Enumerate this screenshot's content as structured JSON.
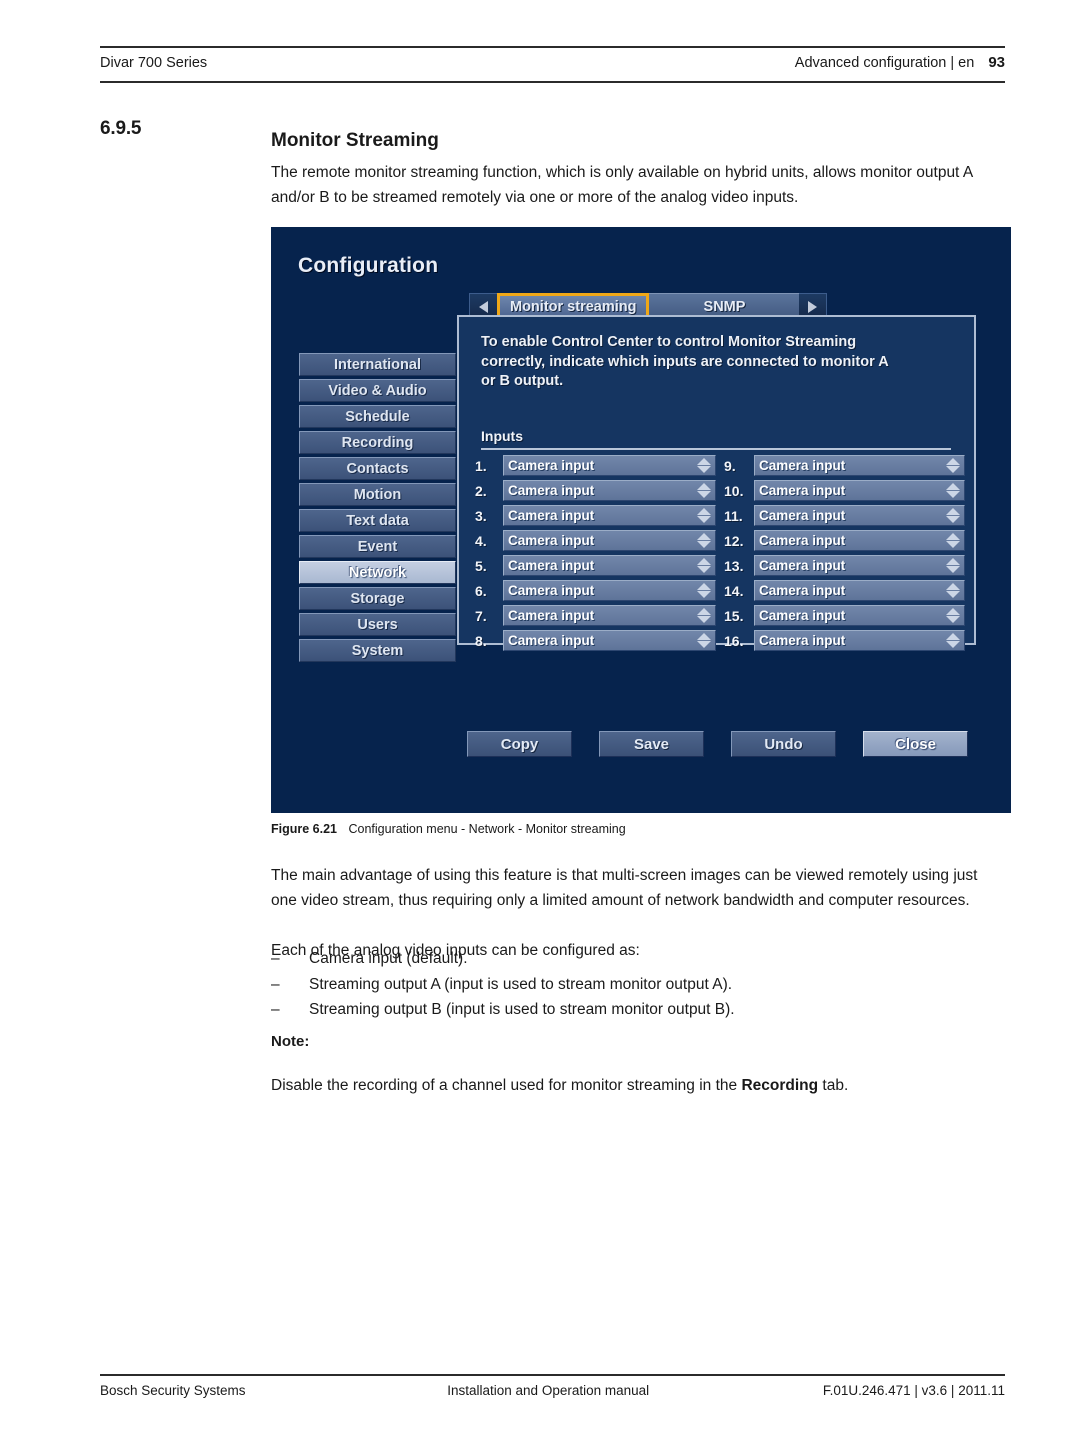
{
  "header": {
    "left": "Divar 700 Series",
    "right": "Advanced configuration | en",
    "page_number": "93"
  },
  "section": {
    "number": "6.9.5",
    "title": "Monitor Streaming",
    "intro": "The remote monitor streaming function, which is only available on hybrid units, allows monitor output A and/or B to be streamed remotely via one or more of the analog video inputs."
  },
  "figure": {
    "caption_label": "Figure 6.21",
    "caption_text": "Configuration menu - Network - Monitor streaming",
    "screenshot": {
      "window_title": "Configuration",
      "colors": {
        "background": "#06234d",
        "panel": "#153561",
        "panel_border": "#aebdd3",
        "tab_focus": "#f0a818",
        "button_face": "#4e658c",
        "highlight": "#a9b8d1"
      },
      "tabs": {
        "prev_arrow": "◀",
        "next_arrow": "▶",
        "items": [
          {
            "label": "Monitor streaming",
            "active": true
          },
          {
            "label": "SNMP",
            "active": false
          }
        ]
      },
      "sidebar": {
        "items": [
          {
            "label": "International",
            "active": false
          },
          {
            "label": "Video & Audio",
            "active": false
          },
          {
            "label": "Schedule",
            "active": false
          },
          {
            "label": "Recording",
            "active": false
          },
          {
            "label": "Contacts",
            "active": false
          },
          {
            "label": "Motion",
            "active": false
          },
          {
            "label": "Text data",
            "active": false
          },
          {
            "label": "Event",
            "active": false
          },
          {
            "label": "Network",
            "active": true
          },
          {
            "label": "Storage",
            "active": false
          },
          {
            "label": "Users",
            "active": false
          },
          {
            "label": "System",
            "active": false
          }
        ]
      },
      "panel": {
        "description": "To enable Control Center to control Monitor Streaming correctly, indicate which inputs are connected to monitor A or B output.",
        "inputs_label": "Inputs",
        "inputs_left": [
          {
            "num": "1.",
            "value": "Camera input"
          },
          {
            "num": "2.",
            "value": "Camera input"
          },
          {
            "num": "3.",
            "value": "Camera input"
          },
          {
            "num": "4.",
            "value": "Camera input"
          },
          {
            "num": "5.",
            "value": "Camera input"
          },
          {
            "num": "6.",
            "value": "Camera input"
          },
          {
            "num": "7.",
            "value": "Camera input"
          },
          {
            "num": "8.",
            "value": "Camera input"
          }
        ],
        "inputs_right": [
          {
            "num": "9.",
            "value": "Camera input"
          },
          {
            "num": "10.",
            "value": "Camera input"
          },
          {
            "num": "11.",
            "value": "Camera input"
          },
          {
            "num": "12.",
            "value": "Camera input"
          },
          {
            "num": "13.",
            "value": "Camera input"
          },
          {
            "num": "14.",
            "value": "Camera input"
          },
          {
            "num": "15.",
            "value": "Camera input"
          },
          {
            "num": "16.",
            "value": "Camera input"
          }
        ]
      },
      "buttons": [
        {
          "label": "Copy",
          "highlight": false
        },
        {
          "label": "Save",
          "highlight": false
        },
        {
          "label": "Undo",
          "highlight": false
        },
        {
          "label": "Close",
          "highlight": true
        }
      ]
    }
  },
  "body": {
    "para_1": "The main advantage of using this feature is that multi-screen images can be viewed remotely using just one video stream, thus requiring only a limited amount of network bandwidth and computer resources.",
    "para_2": "Each of the analog video inputs can be configured as:",
    "bullet_dash": "–",
    "bullets": [
      "Camera input (default).",
      "Streaming output A (input is used to stream monitor output A).",
      "Streaming output B (input is used to stream monitor output B)."
    ],
    "note_label": "Note:",
    "note_prefix": "Disable the recording of a channel used for monitor streaming in the ",
    "note_bold": "Recording",
    "note_suffix": " tab."
  },
  "footer": {
    "left": "Bosch Security Systems",
    "center": "Installation and Operation manual",
    "right": "F.01U.246.471 | v3.6 | 2011.11"
  }
}
